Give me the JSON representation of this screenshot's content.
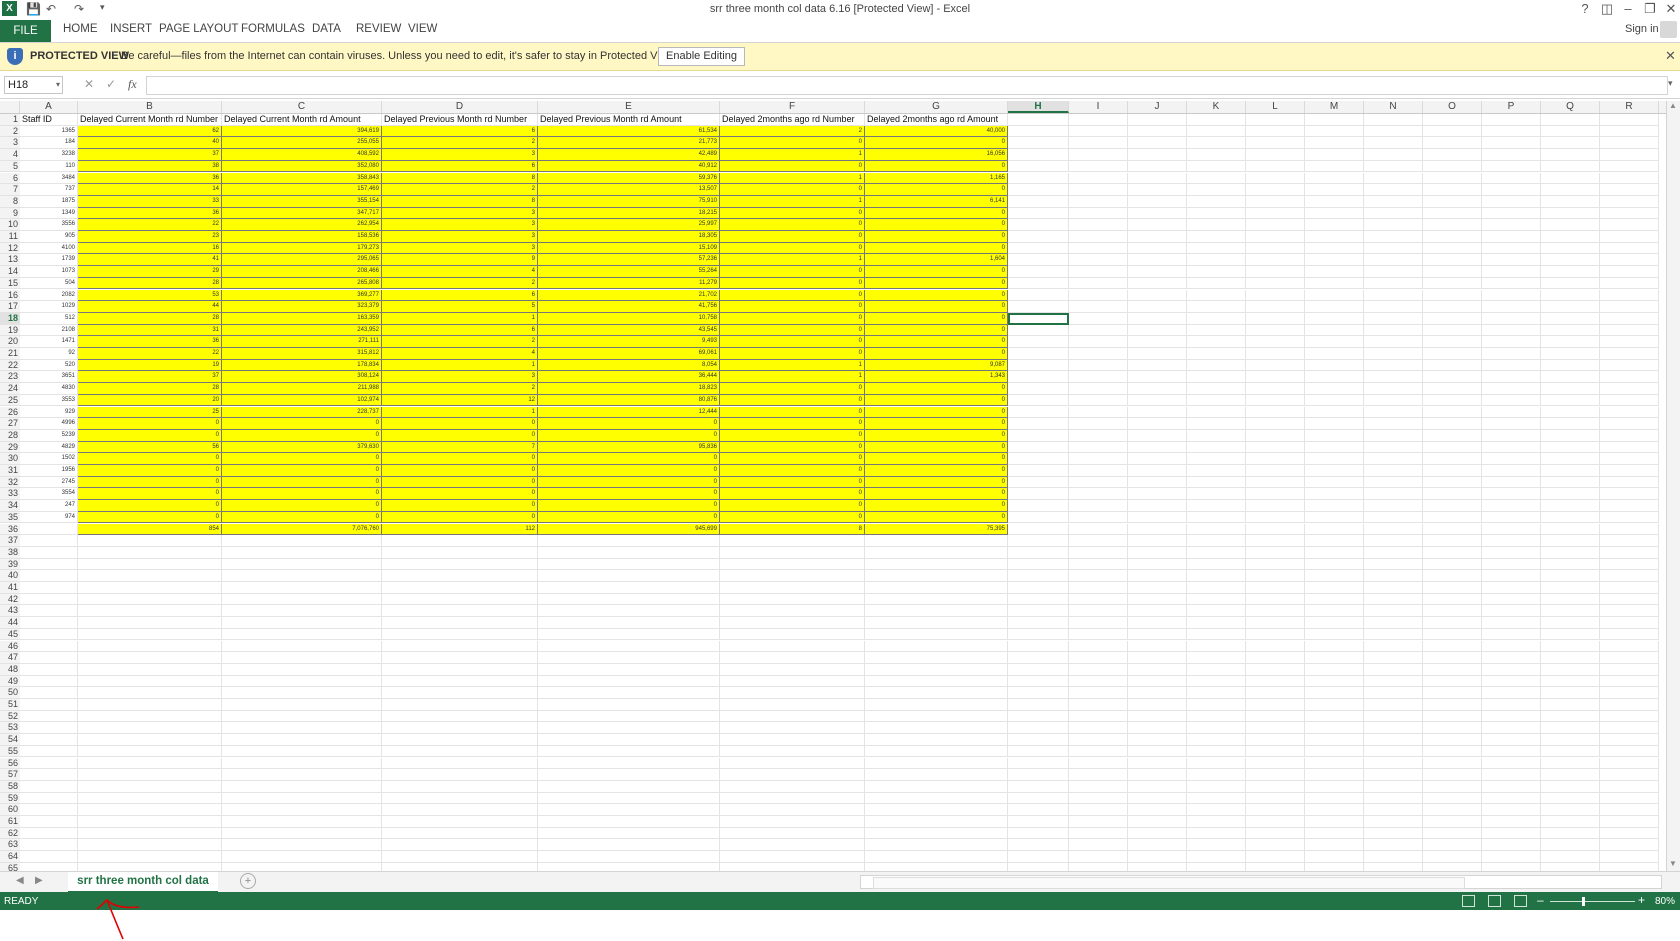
{
  "window": {
    "title": "srr three month col data 6.16  [Protected View] - Excel",
    "app_icon": "X",
    "help": "?",
    "sign_in": "Sign in"
  },
  "ribbon": {
    "file": "FILE",
    "tabs": [
      "HOME",
      "INSERT",
      "PAGE LAYOUT",
      "FORMULAS",
      "DATA",
      "REVIEW",
      "VIEW"
    ]
  },
  "protected_view": {
    "title": "PROTECTED VIEW",
    "message": "Be careful—files from the Internet can contain viruses. Unless you need to edit, it's safer to stay in Protected View.",
    "button": "Enable Editing",
    "close": "✕"
  },
  "formula_bar": {
    "name_box": "H18",
    "fx": "fx",
    "value": ""
  },
  "columns": [
    "A",
    "B",
    "C",
    "D",
    "E",
    "F",
    "G",
    "H",
    "I",
    "J",
    "K",
    "L",
    "M",
    "N",
    "O",
    "P",
    "Q",
    "R"
  ],
  "selected_column": "H",
  "selected_row": 18,
  "sheet": {
    "headers": [
      "Staff ID",
      "Delayed Current Month rd Number",
      "Delayed Current Month rd Amount",
      "Delayed Previous Month rd Number",
      "Delayed Previous Month rd Amount",
      "Delayed 2months ago rd Number",
      "Delayed 2months ago rd Amount"
    ],
    "rows": [
      [
        "1365",
        "62",
        "394,619",
        "6",
        "61,534",
        "2",
        "40,000"
      ],
      [
        "184",
        "40",
        "255,055",
        "2",
        "21,773",
        "0",
        "0"
      ],
      [
        "3238",
        "37",
        "408,592",
        "3",
        "42,489",
        "1",
        "16,056"
      ],
      [
        "110",
        "38",
        "352,080",
        "6",
        "40,912",
        "0",
        "0"
      ],
      [
        "3484",
        "36",
        "358,843",
        "8",
        "59,376",
        "1",
        "1,165"
      ],
      [
        "737",
        "14",
        "157,469",
        "2",
        "13,507",
        "0",
        "0"
      ],
      [
        "1875",
        "33",
        "355,154",
        "8",
        "75,910",
        "1",
        "6,141"
      ],
      [
        "1349",
        "36",
        "347,717",
        "3",
        "18,215",
        "0",
        "0"
      ],
      [
        "3556",
        "22",
        "262,954",
        "3",
        "25,997",
        "0",
        "0"
      ],
      [
        "905",
        "23",
        "158,536",
        "3",
        "18,305",
        "0",
        "0"
      ],
      [
        "4100",
        "16",
        "179,273",
        "3",
        "15,109",
        "0",
        "0"
      ],
      [
        "1739",
        "41",
        "295,065",
        "9",
        "57,236",
        "1",
        "1,604"
      ],
      [
        "1073",
        "29",
        "208,466",
        "4",
        "55,264",
        "0",
        "0"
      ],
      [
        "504",
        "28",
        "265,808",
        "2",
        "11,279",
        "0",
        "0"
      ],
      [
        "2082",
        "53",
        "369,277",
        "6",
        "21,702",
        "0",
        "0"
      ],
      [
        "1029",
        "44",
        "323,379",
        "5",
        "41,756",
        "0",
        "0"
      ],
      [
        "512",
        "28",
        "163,359",
        "1",
        "10,758",
        "0",
        "0"
      ],
      [
        "2108",
        "31",
        "243,952",
        "6",
        "43,545",
        "0",
        "0"
      ],
      [
        "1471",
        "36",
        "271,111",
        "2",
        "9,493",
        "0",
        "0"
      ],
      [
        "92",
        "22",
        "315,812",
        "4",
        "69,061",
        "0",
        "0"
      ],
      [
        "520",
        "19",
        "178,834",
        "1",
        "8,054",
        "1",
        "9,087"
      ],
      [
        "3651",
        "37",
        "308,124",
        "3",
        "36,444",
        "1",
        "1,343"
      ],
      [
        "4830",
        "28",
        "211,988",
        "2",
        "18,823",
        "0",
        "0"
      ],
      [
        "3553",
        "20",
        "102,974",
        "12",
        "80,876",
        "0",
        "0"
      ],
      [
        "929",
        "25",
        "228,737",
        "1",
        "12,444",
        "0",
        "0"
      ],
      [
        "4996",
        "0",
        "0",
        "0",
        "0",
        "0",
        "0"
      ],
      [
        "5239",
        "0",
        "0",
        "0",
        "0",
        "0",
        "0"
      ],
      [
        "4829",
        "56",
        "379,630",
        "7",
        "95,836",
        "0",
        "0"
      ],
      [
        "1502",
        "0",
        "0",
        "0",
        "0",
        "0",
        "0"
      ],
      [
        "1956",
        "0",
        "0",
        "0",
        "0",
        "0",
        "0"
      ],
      [
        "2745",
        "0",
        "0",
        "0",
        "0",
        "0",
        "0"
      ],
      [
        "3554",
        "0",
        "0",
        "0",
        "0",
        "0",
        "0"
      ],
      [
        "247",
        "0",
        "0",
        "0",
        "0",
        "0",
        "0"
      ],
      [
        "974",
        "0",
        "0",
        "0",
        "0",
        "0",
        "0"
      ]
    ],
    "totals": [
      "",
      "854",
      "7,076,760",
      "112",
      "945,699",
      "8",
      "75,395"
    ]
  },
  "sheet_tab": "srr three month col data",
  "status": {
    "ready": "READY",
    "zoom": "80%"
  },
  "colors": {
    "excel_green": "#217346",
    "highlight_yellow": "#ffff00",
    "annotation_red": "#e00000"
  }
}
